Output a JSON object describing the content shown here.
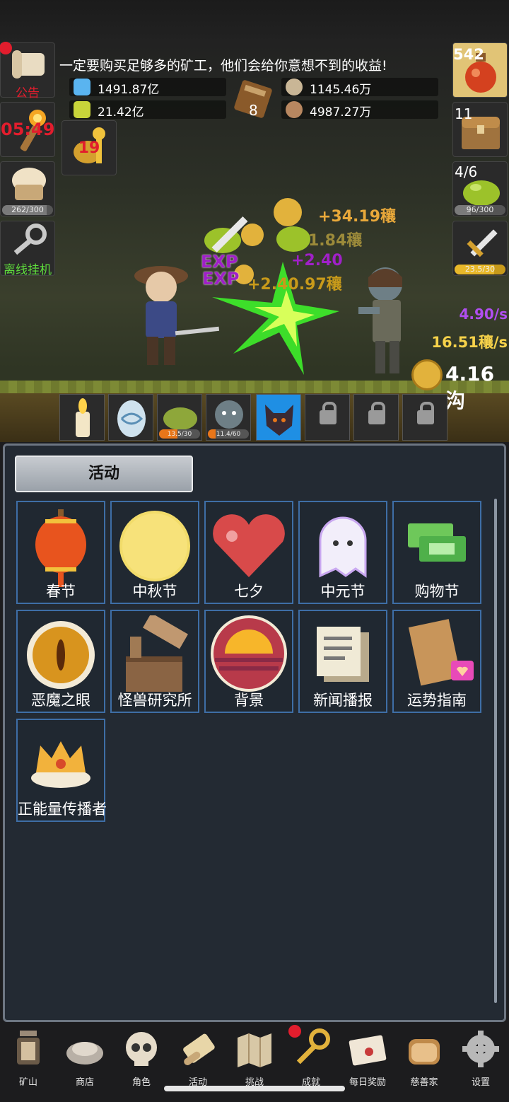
{
  "ticker": "一定要购买足够多的矿工，他们会给你意想不到的收益!",
  "left_tiles": {
    "notice": "公告",
    "timer": "05:49",
    "stamina": "262/300",
    "offline": "离线挂机"
  },
  "key_count": "19",
  "resources": {
    "blue_potion": "1491.87亿",
    "green_potion": "21.42亿",
    "book": "8",
    "coin": "1145.46万",
    "meat": "4987.27万"
  },
  "right_tiles": {
    "potion_count": "542",
    "chest_count": "11",
    "slime_count": "4/6",
    "slime_bar": "96/300",
    "sword_bar": "23.5/30"
  },
  "battle": {
    "float_1": "+34.19穰",
    "float_2": "1.84穰",
    "float_3": "+2.40",
    "float_4": "+2.40.97穰",
    "exp": "EXP",
    "rate_1": "4.90/s",
    "rate_2": "16.51穰/s",
    "gold": "4.16沟"
  },
  "skills": {
    "slime_bar": "13.5/30",
    "zombie_bar": "11.4/60"
  },
  "panel": {
    "tab": "活动",
    "cards": [
      "春节",
      "中秋节",
      "七夕",
      "中元节",
      "购物节",
      "恶魔之眼",
      "怪兽研究所",
      "背景",
      "新闻播报",
      "运势指南",
      "正能量传播者"
    ]
  },
  "nav": [
    "矿山",
    "商店",
    "角色",
    "活动",
    "挑战",
    "成就",
    "每日奖励",
    "慈善家",
    "设置"
  ],
  "colors": {
    "accent_blue": "#1f8fe4",
    "panel_bg": "#232a33",
    "card_border": "#3e6ea6",
    "timer_red": "#e21d2d",
    "rate_purple": "#b04ef0",
    "rate_yellow": "#f6d24a"
  }
}
